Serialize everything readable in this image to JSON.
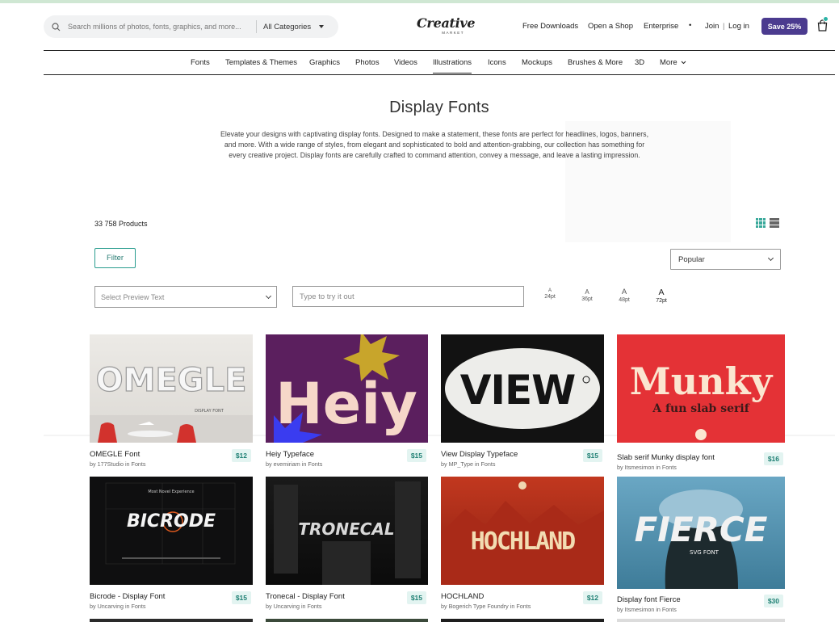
{
  "header": {
    "search_placeholder": "Search millions of photos, fonts, graphics, and more...",
    "category_select": "All Categories",
    "logo_word": "Creative",
    "logo_sub": "MARKET",
    "nav": [
      "Free Downloads",
      "Open a Shop",
      "Enterprise",
      "•",
      "Join",
      "|",
      "Log in"
    ],
    "save_button": "Save 25%"
  },
  "category_nav": {
    "items": [
      "Fonts",
      "Templates & Themes",
      "Graphics",
      "Photos",
      "Videos",
      "Illustrations",
      "Icons",
      "Mockups",
      "Brushes & More",
      "3D",
      "More"
    ],
    "active": "Illustrations"
  },
  "page": {
    "title": "Display Fonts",
    "description": "Elevate your designs with captivating display fonts. Designed to make a statement, these fonts are perfect for headlines, logos, banners, and more. With a wide range of styles, from elegant and sophisticated to bold and attention-grabbing, our collection has something for every creative project. Display fonts are carefully crafted to command attention, convey a message, and leave a lasting impression."
  },
  "toolbar": {
    "product_count": "33 758 Products",
    "filter_label": "Filter",
    "sort_value": "Popular",
    "preview_select_placeholder": "Select Preview Text",
    "try_placeholder": "Type to try it out",
    "sizes": [
      {
        "glyph": "A",
        "label": "24pt"
      },
      {
        "glyph": "A",
        "label": "36pt"
      },
      {
        "glyph": "A",
        "label": "48pt"
      },
      {
        "glyph": "A",
        "label": "72pt"
      }
    ]
  },
  "products": [
    {
      "name": "OMEGLE Font",
      "by": "by 177Studio in Fonts",
      "price": "$12",
      "art": "OMEGLE",
      "art_sub": "DISPLAY FONT"
    },
    {
      "name": "Heiy Typeface",
      "by": "by evemiriam in Fonts",
      "price": "$15",
      "art": "Heiy"
    },
    {
      "name": "View Display Typeface",
      "by": "by MP_Type in Fonts",
      "price": "$15",
      "art": "VIEW"
    },
    {
      "name": "Slab serif Munky display font",
      "by": "by Itsmesimon in Fonts",
      "price": "$16",
      "art": "Munky",
      "art_sub": "A fun slab serif"
    },
    {
      "name": "Bicrode - Display Font",
      "by": "by Uncarving in Fonts",
      "price": "$15",
      "art": "BICRODE",
      "art_top": "Most Novel Experience"
    },
    {
      "name": "Tronecal - Display Font",
      "by": "by Uncarving in Fonts",
      "price": "$15",
      "art": "TRONECAL"
    },
    {
      "name": "HOCHLAND",
      "by": "by Bogerich Type Foundry in Fonts",
      "price": "$12",
      "art": "HOCHLAND"
    },
    {
      "name": "Display font Fierce",
      "by": "by Itsmesimon in Fonts",
      "price": "$30",
      "art": "FIERCE",
      "art_sub": "SVG FONT"
    }
  ],
  "colors": {
    "brand_purple": "#4b3b8f",
    "teal": "#2a9d8f",
    "price_bg": "#e3f4f1"
  },
  "icons": [
    "search-icon",
    "chevron-down-icon",
    "cart-icon",
    "grid-view-icon",
    "list-view-icon"
  ]
}
